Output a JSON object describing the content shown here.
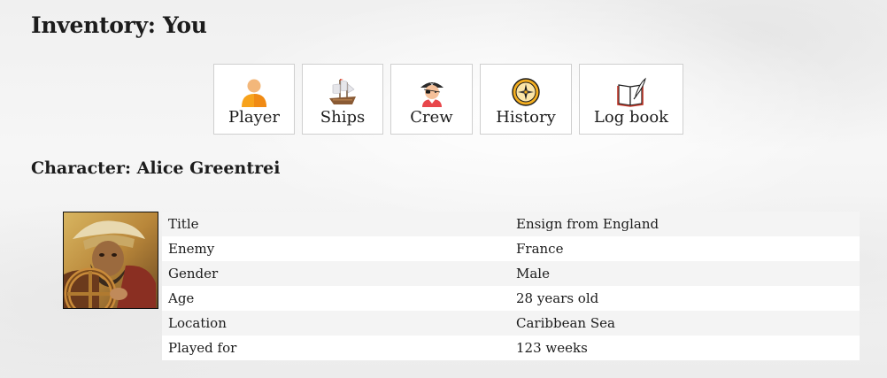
{
  "page": {
    "title": "Inventory: You"
  },
  "nav": {
    "items": [
      {
        "label": "Player",
        "icon": "player-icon"
      },
      {
        "label": "Ships",
        "icon": "ship-icon"
      },
      {
        "label": "Crew",
        "icon": "pirate-icon"
      },
      {
        "label": "History",
        "icon": "compass-icon"
      },
      {
        "label": "Log book",
        "icon": "book-quill-icon"
      }
    ]
  },
  "character": {
    "heading": "Character: Alice Greentrei",
    "portrait": "pirate-captain-portrait",
    "rows": [
      {
        "key": "Title",
        "value": "Ensign from England"
      },
      {
        "key": "Enemy",
        "value": "France"
      },
      {
        "key": "Gender",
        "value": "Male"
      },
      {
        "key": "Age",
        "value": "28 years old"
      },
      {
        "key": "Location",
        "value": "Caribbean Sea"
      },
      {
        "key": "Played for",
        "value": "123 weeks"
      }
    ]
  }
}
